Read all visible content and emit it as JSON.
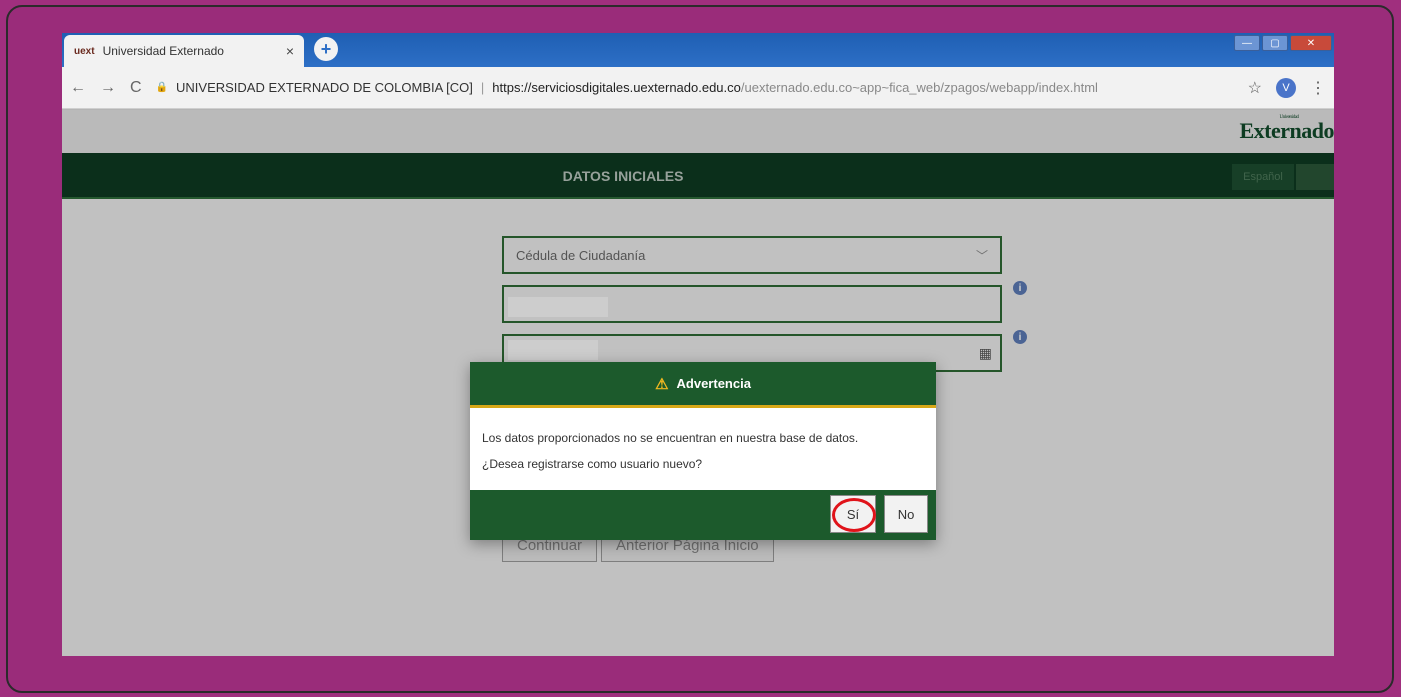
{
  "browser": {
    "tab_title": "Universidad Externado",
    "tab_favicon": "uext",
    "tab_close": "×",
    "new_tab": "+",
    "window_controls": {
      "minimize": "—",
      "maximize": "▢",
      "close": "✕"
    },
    "nav": {
      "back": "←",
      "forward": "→",
      "reload": "C"
    },
    "address": {
      "lock": "🔒",
      "org": "UNIVERSIDAD EXTERNADO DE COLOMBIA [CO]",
      "separator": "|",
      "host": "https://serviciosdigitales.uexternado.edu.co",
      "path": "/uexternado.edu.co~app~fica_web/zpagos/webapp/index.html"
    },
    "star": "☆",
    "profile_initial": "V",
    "menu": "⋮"
  },
  "page": {
    "logo": "Externado",
    "logo_top": "Universidad",
    "header_title": "DATOS INICIALES",
    "language": "Español",
    "document_type": "Cédula de Ciudadanía",
    "select_chevron": "﹀",
    "calendar_icon": "▦",
    "info_icon": "i",
    "buttons": {
      "continue": "Continuar",
      "prev": "Anterior Página Inicio"
    }
  },
  "dialog": {
    "warn_icon": "⚠",
    "title": "Advertencia",
    "message1": "Los datos proporcionados no se encuentran en nuestra base de datos.",
    "message2": "¿Desea registrarse como usuario nuevo?",
    "yes": "Sí",
    "no": "No"
  },
  "colors": {
    "frame": "#9a2c7a",
    "header_green": "#0e3a22",
    "dialog_green": "#1c5a2c",
    "dialog_accent": "#d7a817",
    "highlight_circle": "#e0131a"
  }
}
